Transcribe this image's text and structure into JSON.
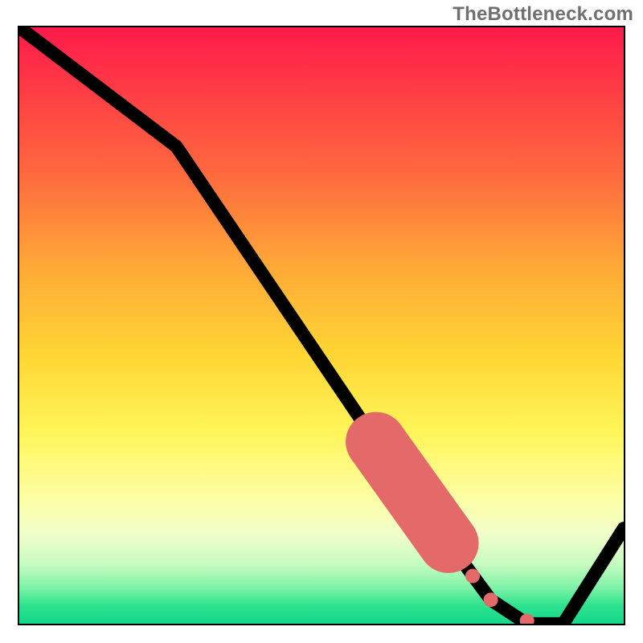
{
  "watermark": "TheBottleneck.com",
  "colors": {
    "curve": "#000000",
    "highlight": "#e46a6a",
    "gradient_top": "#ff1a4a",
    "gradient_mid": "#ffd634",
    "gradient_bottom": "#14d98a"
  },
  "chart_data": {
    "type": "line",
    "title": "",
    "subtitle": "",
    "xlabel": "",
    "ylabel": "",
    "xlim": [
      0,
      100
    ],
    "ylim": [
      0,
      100
    ],
    "grid": false,
    "legend": false,
    "annotations": [
      "TheBottleneck.com"
    ],
    "series": [
      {
        "name": "bottleneck-curve",
        "x": [
          0,
          26,
          60,
          70,
          78,
          84,
          90,
          100
        ],
        "values": [
          100,
          80,
          29,
          15,
          4,
          0,
          0,
          16
        ],
        "note": "y = percent height from bottom (green=0, red=100); curve starts top-left, descends steeply, bottoms out ~x84-90, rises at right edge"
      }
    ],
    "highlight_segment": {
      "name": "recommended-range",
      "x_start": 59,
      "x_end": 71,
      "note": "thick reddish segment overlaid on the descending part of the curve"
    },
    "dots": [
      {
        "x": 75,
        "y": 8
      },
      {
        "x": 78,
        "y": 4
      },
      {
        "x": 84,
        "y": 0.5
      }
    ]
  }
}
